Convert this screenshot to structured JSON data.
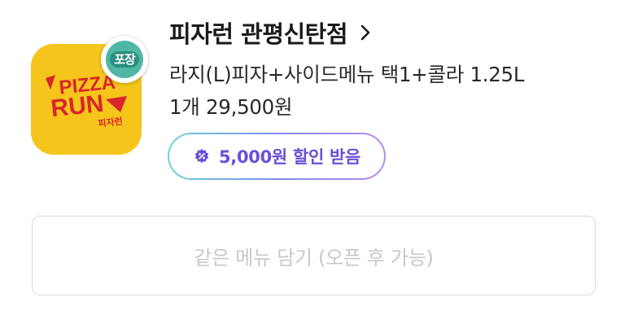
{
  "store": {
    "name": "피자런 관평신탄점",
    "chevron_icon": "chevron-right-icon",
    "logo": {
      "brand_text_top": "PIZZA",
      "brand_text_bottom": "RUN",
      "brand_text_korean": "피자런",
      "background_color": "#f6c51b",
      "text_color": "#d8262b"
    },
    "badge": {
      "label": "포장",
      "color": "#4fb7a4"
    }
  },
  "menu": {
    "line1": "라지(L)피자+사이드메뉴 택1+콜라 1.25L",
    "line2": "1개 29,500원"
  },
  "discount": {
    "label": "5,000원 할인 받음",
    "icon": "coupon-percent-icon",
    "color": "#6a4fd8"
  },
  "actions": {
    "add_same_menu_label": "같은 메뉴 담기 (오픈 후 가능)"
  }
}
